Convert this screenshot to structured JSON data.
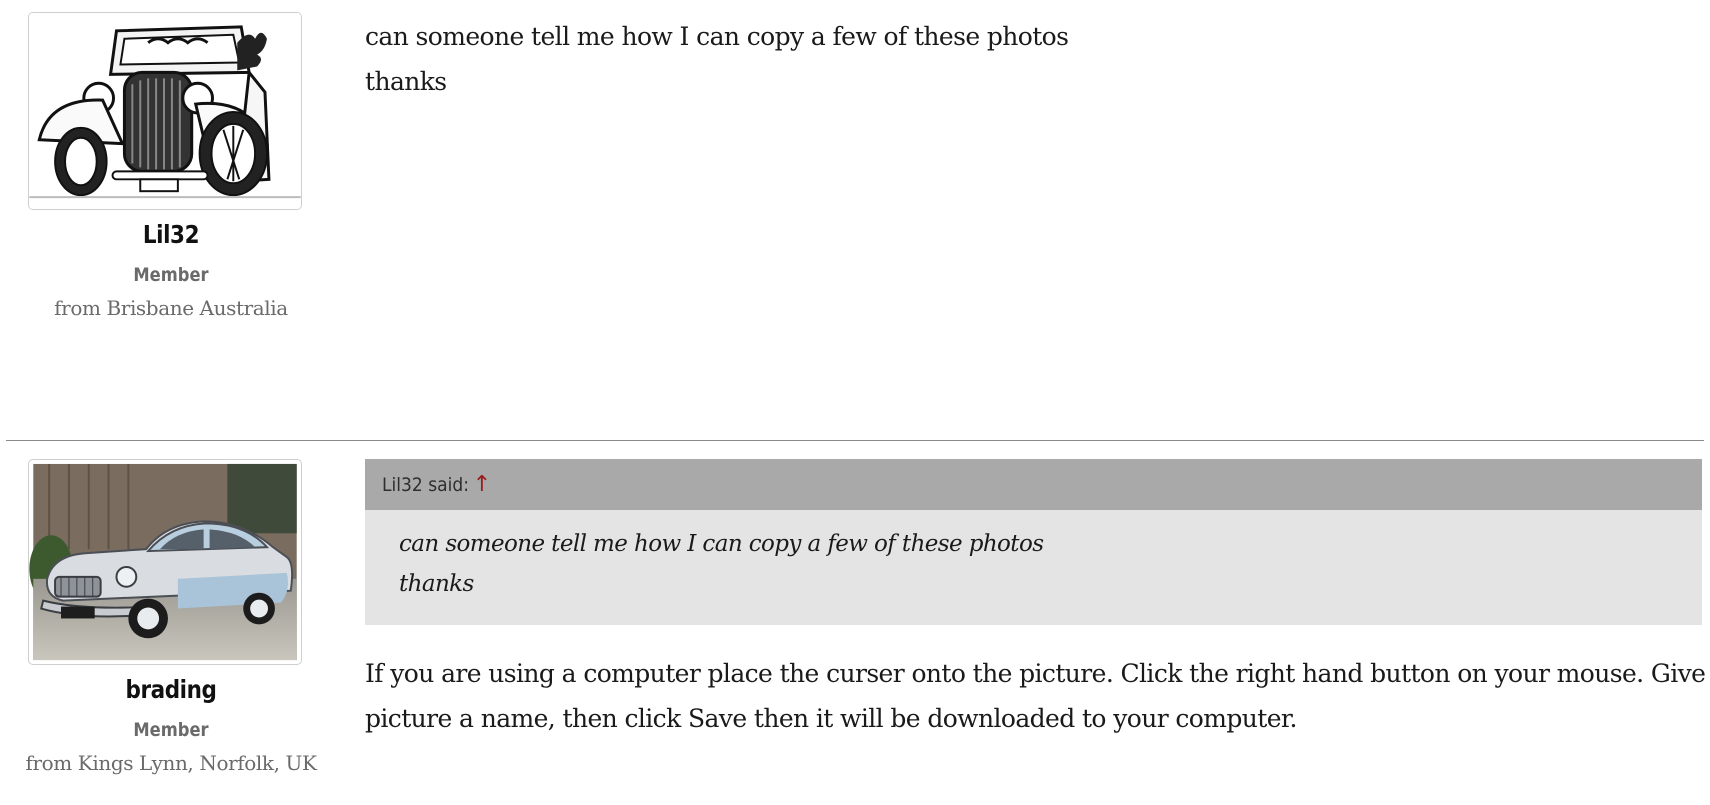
{
  "posts": [
    {
      "user": {
        "name": "Lil32",
        "role": "Member",
        "location": "from Brisbane Australia",
        "avatar": "hot-rod-drawing"
      },
      "message": {
        "lines": [
          "can someone tell me how I can copy a few of these photos",
          "thanks"
        ]
      }
    },
    {
      "user": {
        "name": "brading",
        "role": "Member",
        "location": "from Kings Lynn, Norfolk, UK",
        "avatar": "vintage-car-photo"
      },
      "quote": {
        "author": "Lil32 said:",
        "arrow": "↑",
        "lines": [
          "can someone tell me how I can copy a few of these photos",
          "thanks"
        ]
      },
      "message": {
        "lines": [
          "If you are using a computer place the curser onto the picture. Click the right hand button on your mouse. Give the",
          "picture a name, then click Save then it will be downloaded to your computer."
        ]
      }
    }
  ]
}
